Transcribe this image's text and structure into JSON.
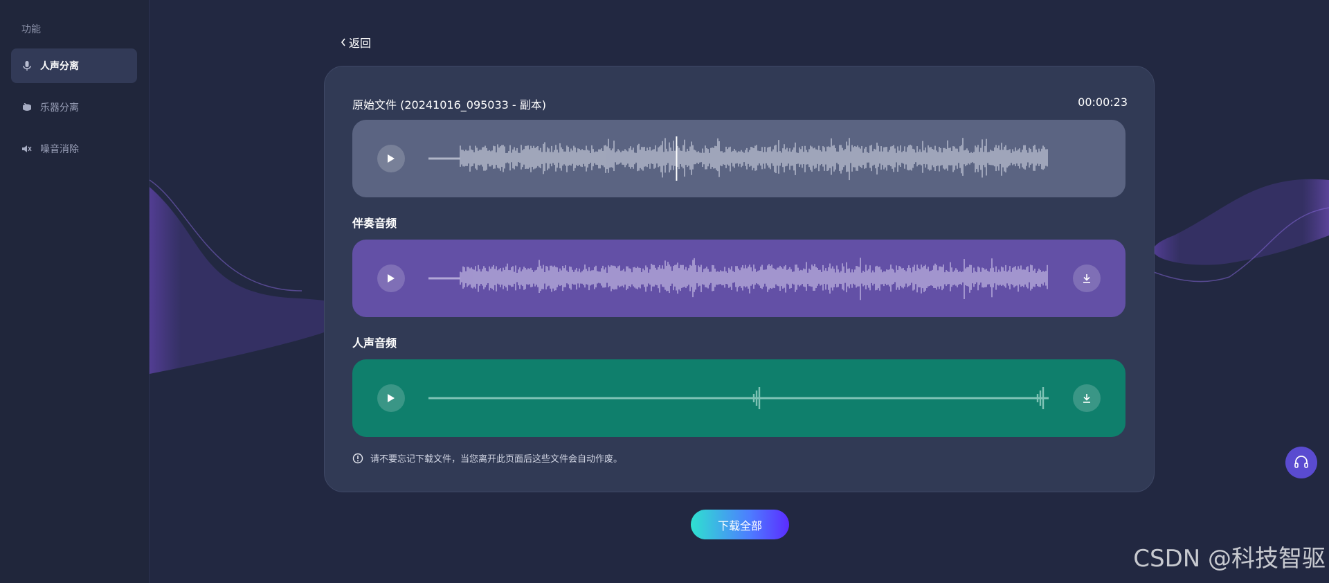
{
  "sidebar": {
    "title": "功能",
    "items": [
      {
        "label": "人声分离",
        "icon": "microphone-icon",
        "active": true
      },
      {
        "label": "乐器分离",
        "icon": "drum-icon",
        "active": false
      },
      {
        "label": "噪音消除",
        "icon": "noise-reduction-icon",
        "active": false
      }
    ]
  },
  "back": {
    "label": "返回"
  },
  "original": {
    "title": "原始文件 (20241016_095033 - 副本)",
    "duration": "00:00:23",
    "playhead": 0.4
  },
  "accompaniment": {
    "label": "伴奏音频"
  },
  "vocal": {
    "label": "人声音频"
  },
  "notice": {
    "text": "请不要忘记下载文件，当您离开此页面后这些文件会自动作废。"
  },
  "download_all": {
    "label": "下载全部"
  },
  "watermark": {
    "text": "CSDN @科技智驱"
  },
  "colors": {
    "original_track": "#5b6482",
    "accompaniment_track": "#6350a6",
    "vocal_track": "#0f7f6c",
    "accent": "#5a4bd0"
  }
}
